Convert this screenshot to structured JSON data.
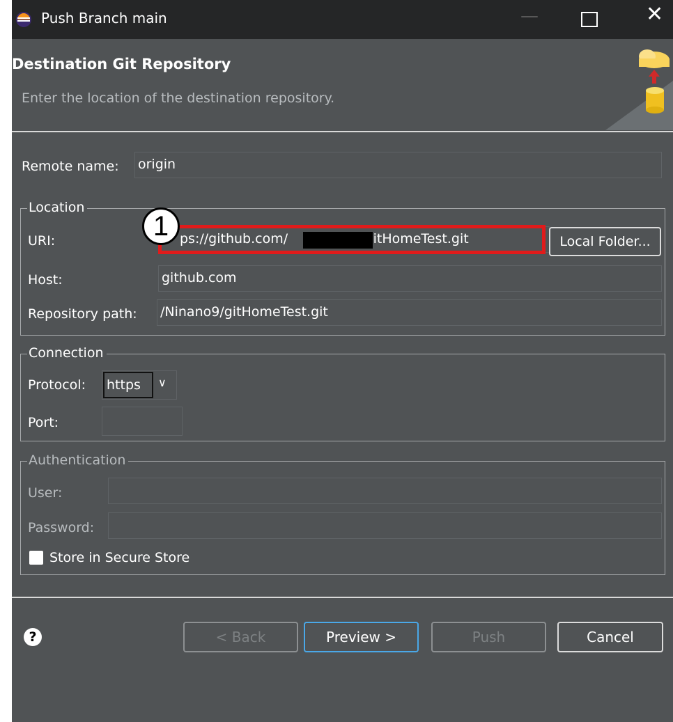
{
  "window": {
    "title": "Push Branch main"
  },
  "header": {
    "title": "Destination Git Repository",
    "subtitle": "Enter the location of the destination repository."
  },
  "remote": {
    "label": "Remote name:",
    "value": "origin"
  },
  "location": {
    "legend": "Location",
    "uri_label": "URI:",
    "uri_prefix": "ps://github.com/",
    "uri_suffix": "/gitHomeTest.git",
    "local_folder_button": "Local Folder...",
    "host_label": "Host:",
    "host_value": "github.com",
    "repo_path_label": "Repository path:",
    "repo_path_value": "/Ninano9/gitHomeTest.git"
  },
  "connection": {
    "legend": "Connection",
    "protocol_label": "Protocol:",
    "protocol_value": "https",
    "port_label": "Port:",
    "port_value": ""
  },
  "authentication": {
    "legend": "Authentication",
    "user_label": "User:",
    "password_label": "Password:",
    "store_label": "Store in Secure Store"
  },
  "annotation": {
    "badge": "1"
  },
  "footer": {
    "back": "< Back",
    "preview": "Preview >",
    "push": "Push",
    "cancel": "Cancel",
    "help_icon": "?"
  },
  "colors": {
    "background": "#505355",
    "titlebar": "#252627",
    "highlight": "#e11b1b",
    "default_button_border": "#4aa8e8"
  }
}
